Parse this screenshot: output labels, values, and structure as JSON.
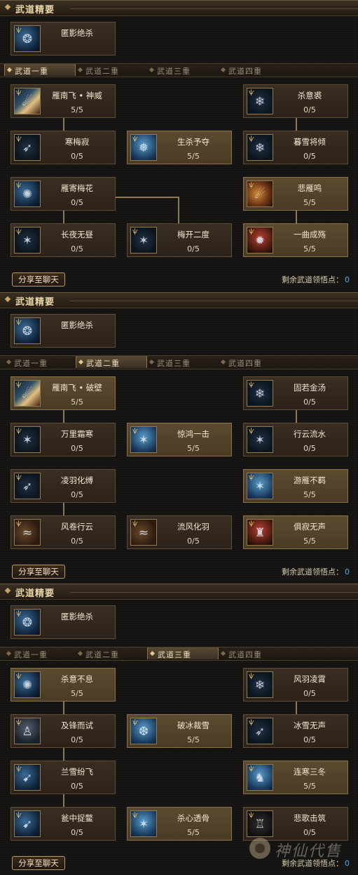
{
  "panels": [
    {
      "header": "武道精要",
      "essence": {
        "name": "匿影绝杀"
      },
      "tabs": [
        "武道一重",
        "武道二重",
        "武道三重",
        "武道四重"
      ],
      "active_tab": 0,
      "skills": [
        {
          "name": "雁南飞 • 神威",
          "level": "5/5",
          "icon": "comet-icon",
          "highlight": false
        },
        {
          "name": "杀意裘",
          "level": "0/5",
          "icon": "frost-wolf-icon",
          "highlight": false
        },
        {
          "name": "寒梅寂",
          "level": "0/5",
          "icon": "feather-icon",
          "highlight": false
        },
        {
          "name": "生杀予夺",
          "level": "5/5",
          "icon": "ice-shard-icon",
          "highlight": true
        },
        {
          "name": "暮雪将倾",
          "level": "0/5",
          "icon": "frost-wolf-icon",
          "highlight": false
        },
        {
          "name": "雁寄梅花",
          "level": "0/5",
          "icon": "blade-swirl-icon",
          "highlight": false
        },
        {
          "name": "悲雁鸣",
          "level": "5/5",
          "icon": "fire-comet-icon",
          "highlight": true
        },
        {
          "name": "长夜无昼",
          "level": "0/5",
          "icon": "claw-icon",
          "highlight": false
        },
        {
          "name": "梅开二度",
          "level": "0/5",
          "icon": "claw-icon",
          "highlight": false
        },
        {
          "name": "一曲成殇",
          "level": "5/5",
          "icon": "blood-burst-icon",
          "highlight": true
        }
      ],
      "share_label": "分享至聊天",
      "remaining_label": "剩余武道领悟点：",
      "remaining_points": "0"
    },
    {
      "header": "武道精要",
      "essence": {
        "name": "匿影绝杀"
      },
      "tabs": [
        "武道一重",
        "武道二重",
        "武道三重",
        "武道四重"
      ],
      "active_tab": 1,
      "skills": [
        {
          "name": "雁南飞 • 破壁",
          "level": "5/5",
          "icon": "comet-icon",
          "highlight": true
        },
        {
          "name": "固若金汤",
          "level": "0/5",
          "icon": "frost-wolf-icon",
          "highlight": false
        },
        {
          "name": "万里霜寒",
          "level": "0/5",
          "icon": "claw-icon",
          "highlight": false
        },
        {
          "name": "惊鸿一击",
          "level": "5/5",
          "icon": "ice-claw-icon",
          "highlight": true
        },
        {
          "name": "行云流水",
          "level": "0/5",
          "icon": "claw-icon",
          "highlight": false
        },
        {
          "name": "凌羽化缚",
          "level": "0/5",
          "icon": "feather-icon",
          "highlight": false
        },
        {
          "name": "游雁不羁",
          "level": "5/5",
          "icon": "ice-claw-icon",
          "highlight": true
        },
        {
          "name": "风卷行云",
          "level": "0/5",
          "icon": "whirlwind-icon",
          "highlight": false
        },
        {
          "name": "流风化羽",
          "level": "0/5",
          "icon": "whirlwind-icon",
          "highlight": false
        },
        {
          "name": "俱寂无声",
          "level": "5/5",
          "icon": "red-warrior-icon",
          "highlight": true
        }
      ],
      "share_label": "分享至聊天",
      "remaining_label": "剩余武道领悟点：",
      "remaining_points": "0"
    },
    {
      "header": "武道精要",
      "essence": {
        "name": "匿影绝杀"
      },
      "tabs": [
        "武道一重",
        "武道二重",
        "武道三重",
        "武道四重"
      ],
      "active_tab": 2,
      "skills": [
        {
          "name": "杀意不息",
          "level": "5/5",
          "icon": "blade-swirl-icon",
          "highlight": true
        },
        {
          "name": "风羽凌霄",
          "level": "0/5",
          "icon": "frost-wolf-icon",
          "highlight": false
        },
        {
          "name": "及锋而试",
          "level": "0/5",
          "icon": "hooded-figure-icon",
          "highlight": false
        },
        {
          "name": "破冰裁雪",
          "level": "5/5",
          "icon": "ice-shatter-icon",
          "highlight": true
        },
        {
          "name": "冰雪无声",
          "level": "0/5",
          "icon": "feather-icon",
          "highlight": false
        },
        {
          "name": "兰雪纷飞",
          "level": "0/5",
          "icon": "shark-blade-icon",
          "highlight": false
        },
        {
          "name": "连寒三冬",
          "level": "5/5",
          "icon": "ice-golem-icon",
          "highlight": true
        },
        {
          "name": "瓮中捉鳖",
          "level": "0/5",
          "icon": "shark-blade-icon",
          "highlight": false
        },
        {
          "name": "杀心透骨",
          "level": "5/5",
          "icon": "ice-claw-icon",
          "highlight": true
        },
        {
          "name": "悲歌击筑",
          "level": "0/5",
          "icon": "shadow-ruin-icon",
          "highlight": false
        }
      ],
      "share_label": "分享至聊天",
      "remaining_label": "剩余武道领悟点：",
      "remaining_points": "0"
    }
  ],
  "watermark": "神仙代售"
}
